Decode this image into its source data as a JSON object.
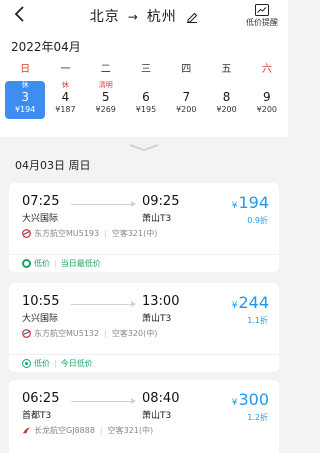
{
  "header": {
    "origin": "北京",
    "arrow": "→",
    "destination": "杭州",
    "price_alert_label": "低价提醒"
  },
  "calendar": {
    "month": "2022年04月",
    "weekdays": [
      "日",
      "一",
      "二",
      "三",
      "四",
      "五",
      "六"
    ],
    "days": [
      {
        "tag": "休",
        "day": "3",
        "price": "¥194",
        "selected": true
      },
      {
        "tag": "休",
        "day": "4",
        "price": "¥187"
      },
      {
        "tag": "清明",
        "day": "5",
        "price": "¥269"
      },
      {
        "tag": "",
        "day": "6",
        "price": "¥195"
      },
      {
        "tag": "",
        "day": "7",
        "price": "¥200"
      },
      {
        "tag": "",
        "day": "8",
        "price": "¥200"
      },
      {
        "tag": "",
        "day": "9",
        "price": "¥200"
      }
    ]
  },
  "date_header": "04月03日 周日",
  "flights": [
    {
      "dep_time": "07:25",
      "dep_airport": "大兴国际",
      "arr_time": "09:25",
      "arr_airport": "萧山T3",
      "currency": "¥",
      "price": "194",
      "discount": "0.9折",
      "airline": "东方航空MU5193",
      "aircraft": "空客321(中)",
      "promo_tag": "低价",
      "promo_text": "当日最低价"
    },
    {
      "dep_time": "10:55",
      "dep_airport": "大兴国际",
      "arr_time": "13:00",
      "arr_airport": "萧山T3",
      "currency": "¥",
      "price": "244",
      "discount": "1.1折",
      "airline": "东方航空MU5132",
      "aircraft": "空客320(中)",
      "promo_tag": "低价",
      "promo_text": "今日低价"
    },
    {
      "dep_time": "06:25",
      "dep_airport": "首都T3",
      "arr_time": "08:40",
      "arr_airport": "萧山T3",
      "currency": "¥",
      "price": "300",
      "discount": "1.2折",
      "airline": "长龙航空GJ8888",
      "aircraft": "空客321(中)"
    }
  ],
  "colors": {
    "accent": "#1f99f0",
    "selected_day": "#3d8ef0",
    "holiday_red": "#e23a2e",
    "promo_green": "#1ea362"
  }
}
